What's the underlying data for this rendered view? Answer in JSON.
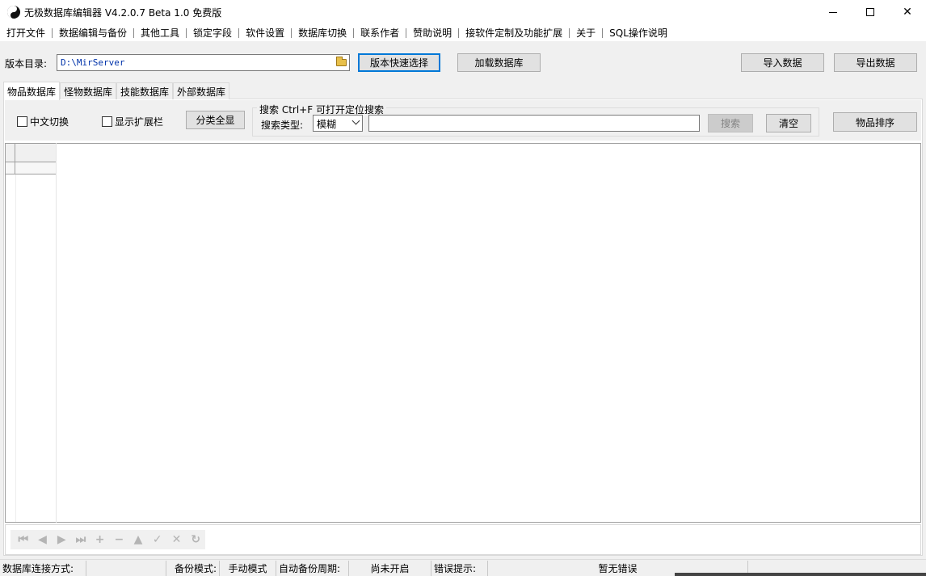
{
  "window": {
    "title": "无极数据库编辑器 V4.2.0.7      Beta 1.0 免费版"
  },
  "menu": [
    "打开文件",
    "数据编辑与备份",
    "其他工具",
    "锁定字段",
    "软件设置",
    "数据库切换",
    "联系作者",
    "赞助说明",
    "接软件定制及功能扩展",
    "关于",
    "SQL操作说明"
  ],
  "toolbar": {
    "version_dir_label": "版本目录:",
    "version_dir_value": "D:\\MirServer",
    "quick_select_label": "版本快速选择",
    "load_db_label": "加载数据库",
    "import_label": "导入数据",
    "export_label": "导出数据"
  },
  "tabs": [
    {
      "label": "物品数据库",
      "active": true
    },
    {
      "label": "怪物数据库",
      "active": false
    },
    {
      "label": "技能数据库",
      "active": false
    },
    {
      "label": "外部数据库",
      "active": false
    }
  ],
  "filters": {
    "chinese_toggle_label": "中文切换",
    "chinese_toggle_checked": false,
    "show_ext_label": "显示扩展栏",
    "show_ext_checked": false,
    "show_all_categories_label": "分类全显"
  },
  "search": {
    "group_title": "搜索  Ctrl+F 可打开定位搜索",
    "type_label": "搜索类型:",
    "type_value": "模糊",
    "query_value": "",
    "search_label": "搜索",
    "clear_label": "清空",
    "sort_label": "物品排序"
  },
  "navigator": {
    "buttons": [
      "first-icon",
      "prior-icon",
      "next-icon",
      "last-icon",
      "insert-icon",
      "delete-icon",
      "edit-icon",
      "post-icon",
      "cancel-icon",
      "refresh-icon"
    ],
    "glyphs": [
      "⏮",
      "◀",
      "▶",
      "⏭",
      "+",
      "−",
      "▲",
      "✓",
      "✕",
      "↻"
    ]
  },
  "status": {
    "connection_label": "数据库连接方式:",
    "connection_value": "",
    "backup_mode_label": "备份模式:",
    "backup_mode_value": "手动模式",
    "auto_backup_label": "自动备份周期:",
    "auto_backup_value": "尚未开启",
    "error_label": "错误提示:",
    "error_value": "暂无错误"
  }
}
